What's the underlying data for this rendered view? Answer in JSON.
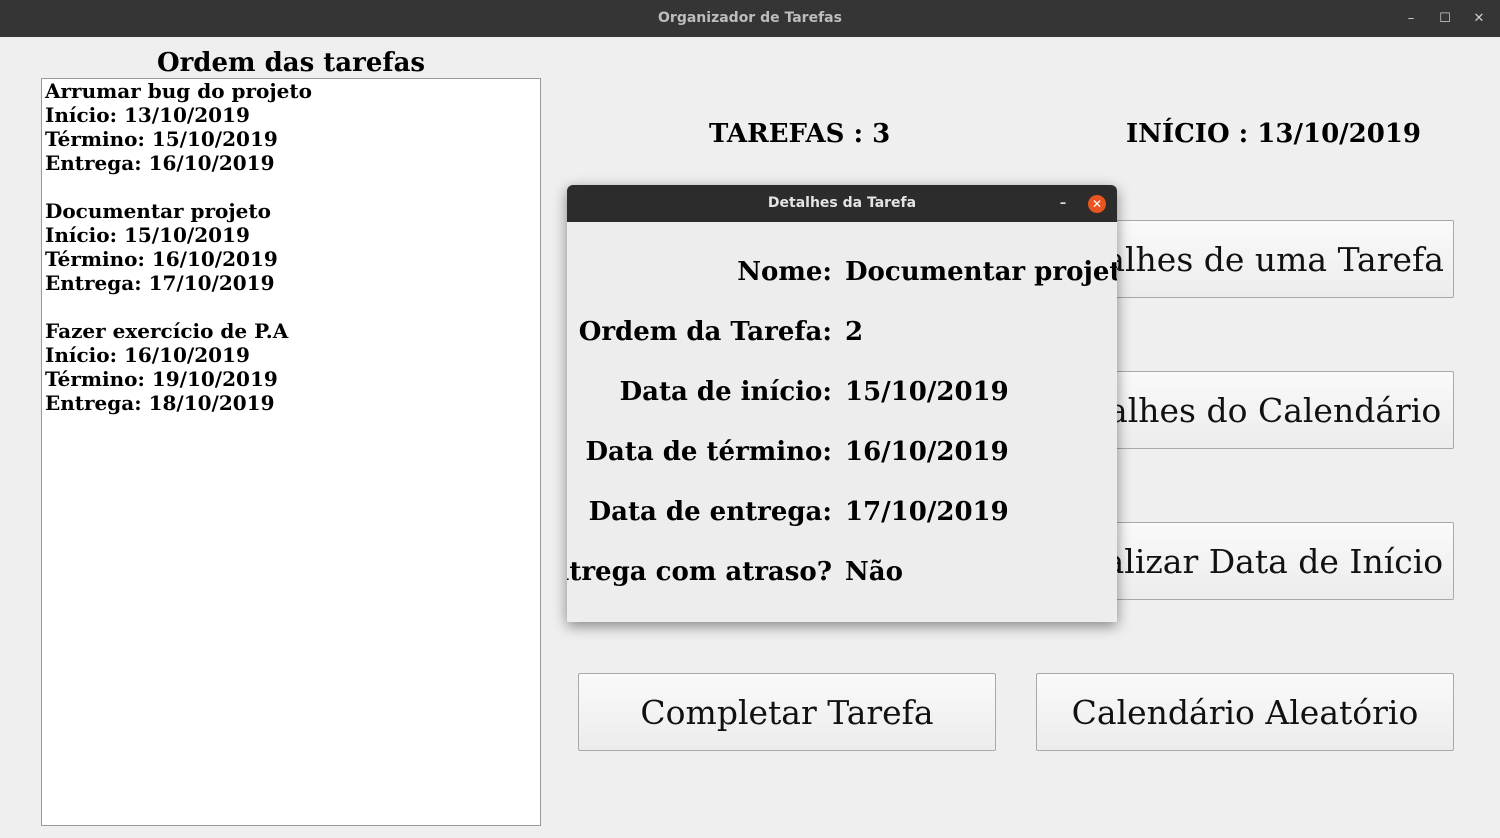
{
  "window": {
    "title": "Organizador de Tarefas",
    "minimize": "–",
    "maximize": "☐",
    "close": "✕"
  },
  "left_panel": {
    "heading": "Ordem das tarefas",
    "tasks": [
      {
        "name": "Arrumar bug do projeto",
        "inicio": "Início: 13/10/2019",
        "termino": "Término: 15/10/2019",
        "entrega": "Entrega: 16/10/2019"
      },
      {
        "name": "Documentar projeto",
        "inicio": "Início: 15/10/2019",
        "termino": "Término: 16/10/2019",
        "entrega": "Entrega: 17/10/2019"
      },
      {
        "name": "Fazer exercício de P.A",
        "inicio": "Início: 16/10/2019",
        "termino": "Término: 19/10/2019",
        "entrega": "Entrega: 18/10/2019"
      }
    ]
  },
  "stats": {
    "tarefas": "TAREFAS : 3",
    "inicio": "INÍCIO : 13/10/2019"
  },
  "buttons": {
    "detalhes_tarefa": "Detalhes de uma Tarefa",
    "detalhes_calendario": "Detalhes do Calendário",
    "atualizar_inicio": "Atualizar Data de Início",
    "completar_tarefa": "Completar Tarefa",
    "calendario_aleatorio": "Calendário Aleatório"
  },
  "dialog": {
    "title": "Detalhes da Tarefa",
    "minimize": "–",
    "close": "✕",
    "fields": [
      {
        "label": "Nome:",
        "value": "Documentar projeto"
      },
      {
        "label": "Ordem da Tarefa:",
        "value": "2"
      },
      {
        "label": "Data de início:",
        "value": "15/10/2019"
      },
      {
        "label": "Data de término:",
        "value": "16/10/2019"
      },
      {
        "label": "Data de entrega:",
        "value": "17/10/2019"
      },
      {
        "label": "Entrega com atraso?",
        "value": "Não"
      }
    ]
  },
  "colors": {
    "titlebar": "#353535",
    "background": "#efefef",
    "dialog_close": "#e95420"
  }
}
